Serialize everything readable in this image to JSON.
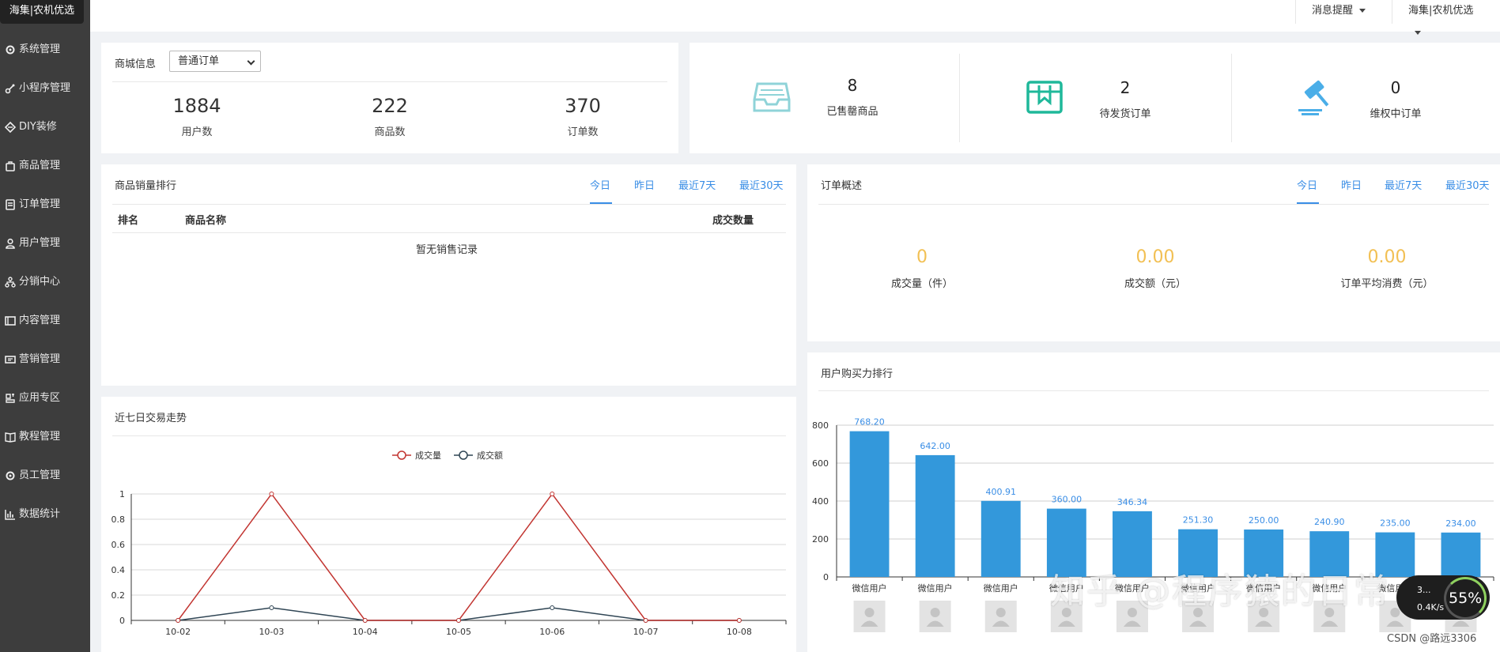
{
  "sidebar": {
    "brand": "海集|农机优选",
    "items": [
      {
        "label": "系统管理",
        "icon": "gear-icon"
      },
      {
        "label": "小程序管理",
        "icon": "link-icon"
      },
      {
        "label": "DIY装修",
        "icon": "diamond-icon"
      },
      {
        "label": "商品管理",
        "icon": "bag-icon"
      },
      {
        "label": "订单管理",
        "icon": "list-icon"
      },
      {
        "label": "用户管理",
        "icon": "user-icon"
      },
      {
        "label": "分销中心",
        "icon": "network-icon"
      },
      {
        "label": "内容管理",
        "icon": "document-icon"
      },
      {
        "label": "营销管理",
        "icon": "ticket-icon"
      },
      {
        "label": "应用专区",
        "icon": "apps-icon"
      },
      {
        "label": "教程管理",
        "icon": "book-icon"
      },
      {
        "label": "员工管理",
        "icon": "gear-icon"
      },
      {
        "label": "数据统计",
        "icon": "chart-icon"
      }
    ]
  },
  "topbar": {
    "messages": "消息提醒",
    "account": "海集|农机优选"
  },
  "store": {
    "title": "商城信息",
    "select_value": "普通订单",
    "stats": [
      {
        "value": "1884",
        "label": "用户数"
      },
      {
        "value": "222",
        "label": "商品数"
      },
      {
        "value": "370",
        "label": "订单数"
      }
    ]
  },
  "cards": [
    {
      "value": "8",
      "label": "已售罄商品",
      "icon": "inbox-icon"
    },
    {
      "value": "2",
      "label": "待发货订单",
      "icon": "bookmark-box-icon"
    },
    {
      "value": "0",
      "label": "维权中订单",
      "icon": "gavel-icon"
    }
  ],
  "ranking": {
    "title": "商品销量排行",
    "tabs": [
      "今日",
      "昨日",
      "最近7天",
      "最近30天"
    ],
    "headers": [
      "排名",
      "商品名称",
      "成交数量"
    ],
    "empty": "暂无销售记录"
  },
  "overview": {
    "title": "订单概述",
    "tabs": [
      "今日",
      "昨日",
      "最近7天",
      "最近30天"
    ],
    "stats": [
      {
        "value": "0",
        "label": "成交量（件）"
      },
      {
        "value": "0.00",
        "label": "成交额（元）"
      },
      {
        "value": "0.00",
        "label": "订单平均消费（元）"
      }
    ]
  },
  "trend": {
    "title": "近七日交易走势"
  },
  "purchase": {
    "title": "用户购买力排行"
  },
  "chart_data": [
    {
      "type": "line",
      "title": "近七日交易走势",
      "x": [
        "10-02",
        "10-03",
        "10-04",
        "10-05",
        "10-06",
        "10-07",
        "10-08"
      ],
      "yticks": [
        "0",
        "0.2",
        "0.4",
        "0.6",
        "0.8",
        "1"
      ],
      "ylim": [
        0,
        1
      ],
      "legend_position": "top-center",
      "series": [
        {
          "name": "成交量",
          "color": "#c23531",
          "values": [
            0,
            1,
            0,
            0,
            1,
            0,
            0
          ]
        },
        {
          "name": "成交额",
          "color": "#2f4554",
          "values": [
            0,
            0.1,
            0,
            0,
            0.1,
            0,
            0
          ]
        }
      ]
    },
    {
      "type": "bar",
      "title": "用户购买力排行",
      "categories": [
        "微信用户",
        "微信用户",
        "微信用户",
        "微信用户",
        "微信用户",
        "微信用户",
        "微信用户",
        "微信用户",
        "微信用户",
        "微信用户"
      ],
      "values": [
        768.2,
        642.0,
        400.91,
        360.0,
        346.34,
        251.3,
        250.0,
        240.9,
        235.0,
        234.0
      ],
      "labels": [
        "768.20",
        "642.00",
        "400.91",
        "360.00",
        "346.34",
        "251.30",
        "250.00",
        "240.90",
        "235.00",
        "234.00"
      ],
      "yticks": [
        "0",
        "200",
        "400",
        "600",
        "800"
      ],
      "ylim": [
        0,
        800
      ],
      "color": "#3398db"
    }
  ],
  "overlay": {
    "watermark": "知乎 @程序猿的日常",
    "csdn": "CSDN @路远3306",
    "speed_top": "3...",
    "speed_bottom": "0.4K/s",
    "speed_pct": "55%"
  }
}
